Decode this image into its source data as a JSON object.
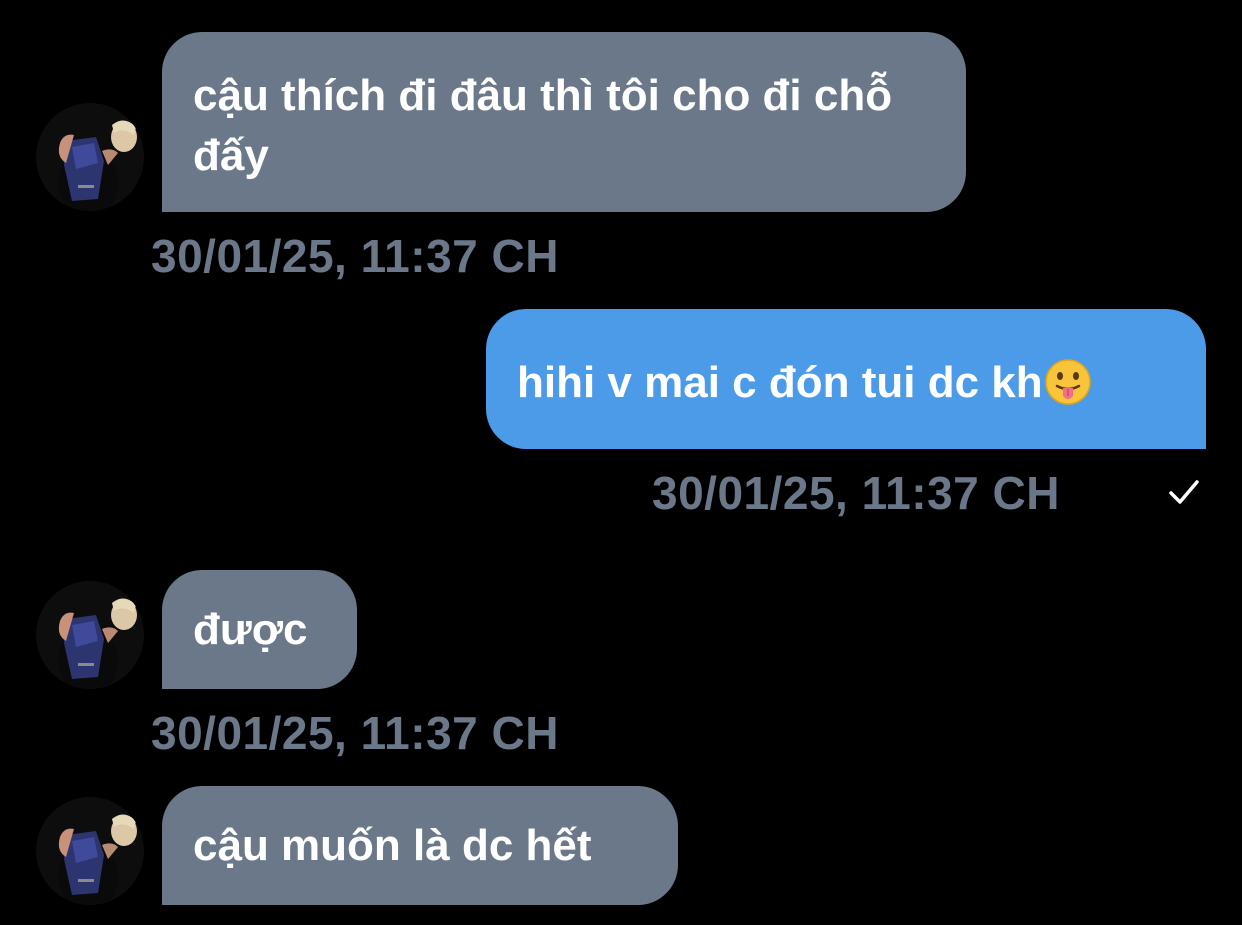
{
  "messages": [
    {
      "direction": "incoming",
      "text": "cậu thích đi đâu thì tôi cho đi chỗ đấy",
      "timestamp": "30/01/25, 11:37 CH"
    },
    {
      "direction": "outgoing",
      "text": "hihi v mai c đón tui dc kh",
      "emoji": "tongue-out-face-emoji",
      "timestamp": "30/01/25, 11:37 CH",
      "status_icon": "checkmark-icon"
    },
    {
      "direction": "incoming",
      "text": "được",
      "timestamp": "30/01/25, 11:37 CH"
    },
    {
      "direction": "incoming",
      "text": "cậu muốn là dc hết"
    }
  ],
  "colors": {
    "background": "#000000",
    "incoming_bubble": "#6b7889",
    "outgoing_bubble": "#4b9be8",
    "timestamp": "#6b7889",
    "text": "#ffffff"
  },
  "icons": {
    "avatar": "contact-avatar-photo",
    "read_status": "checkmark-icon",
    "emoji": "tongue-out-face-emoji"
  }
}
